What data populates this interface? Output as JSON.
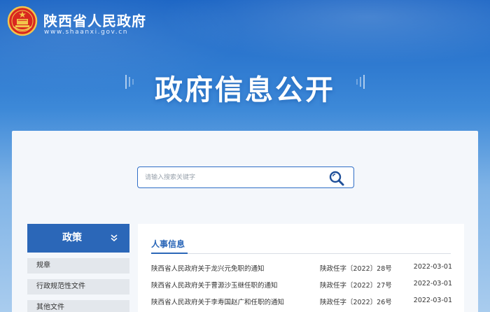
{
  "header": {
    "site_name": "陕西省人民政府",
    "site_url": "www.shaanxi.gov.cn"
  },
  "hero": {
    "title": "政府信息公开"
  },
  "search": {
    "placeholder": "请输入搜索关键字"
  },
  "sidebar": {
    "heading": "政策",
    "items": [
      {
        "label": "规章"
      },
      {
        "label": "行政规范性文件"
      },
      {
        "label": "其他文件"
      }
    ]
  },
  "content": {
    "section_title": "人事信息",
    "rows": [
      {
        "title": "陕西省人民政府关于龙兴元免职的通知",
        "number": "陕政任字〔2022〕28号",
        "date": "2022-03-01"
      },
      {
        "title": "陕西省人民政府关于曹源沙玉继任职的通知",
        "number": "陕政任字〔2022〕27号",
        "date": "2022-03-01"
      },
      {
        "title": "陕西省人民政府关于李寿国赵广和任职的通知",
        "number": "陕政任字〔2022〕26号",
        "date": "2022-03-01"
      }
    ]
  },
  "colors": {
    "primary": "#2b67b8",
    "hero_top": "#1a64c4"
  }
}
